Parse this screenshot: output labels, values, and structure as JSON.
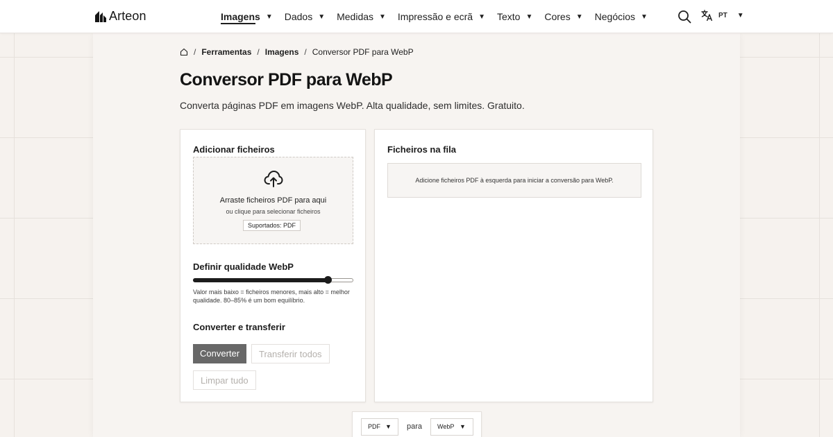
{
  "header": {
    "logo_text": "Arteon",
    "nav": [
      {
        "label": "Imagens",
        "active": true
      },
      {
        "label": "Dados",
        "active": false
      },
      {
        "label": "Medidas",
        "active": false
      },
      {
        "label": "Impressão e ecrã",
        "active": false
      },
      {
        "label": "Texto",
        "active": false
      },
      {
        "label": "Cores",
        "active": false
      },
      {
        "label": "Negócios",
        "active": false
      }
    ],
    "caret": "▼",
    "language": "PT"
  },
  "breadcrumb": {
    "items": [
      "Ferramentas",
      "Imagens",
      "Conversor PDF para WebP"
    ],
    "separator": "/"
  },
  "page": {
    "title": "Conversor PDF para WebP",
    "subtitle": "Converta páginas PDF em imagens WebP. Alta qualidade, sem limites. Gratuito."
  },
  "left_panel": {
    "add_title": "Adicionar ficheiros",
    "dropzone": {
      "title": "Arraste ficheiros PDF para aqui",
      "subtitle": "ou clique para selecionar ficheiros",
      "badge": "Suportados: PDF"
    },
    "quality": {
      "title": "Definir qualidade WebP",
      "level_fraction": 0.84,
      "hint": "Valor mais baixo = ficheiros menores, mais alto = melhor qualidade. 80–85% é um bom equilíbrio."
    },
    "actions": {
      "title": "Converter e transferir",
      "convert_label": "Converter",
      "download_label": "Transferir todos",
      "clear_label": "Limpar tudo"
    }
  },
  "right_panel": {
    "title": "Ficheiros na fila",
    "empty_message": "Adicione ficheiros PDF à esquerda para iniciar a conversão para WebP."
  },
  "format_bar": {
    "from": "PDF",
    "connector": "para",
    "to": "WebP"
  },
  "colors": {
    "page_bg": "#f6f2ee",
    "primary_button": "#686868",
    "text": "#1f1f1f"
  }
}
